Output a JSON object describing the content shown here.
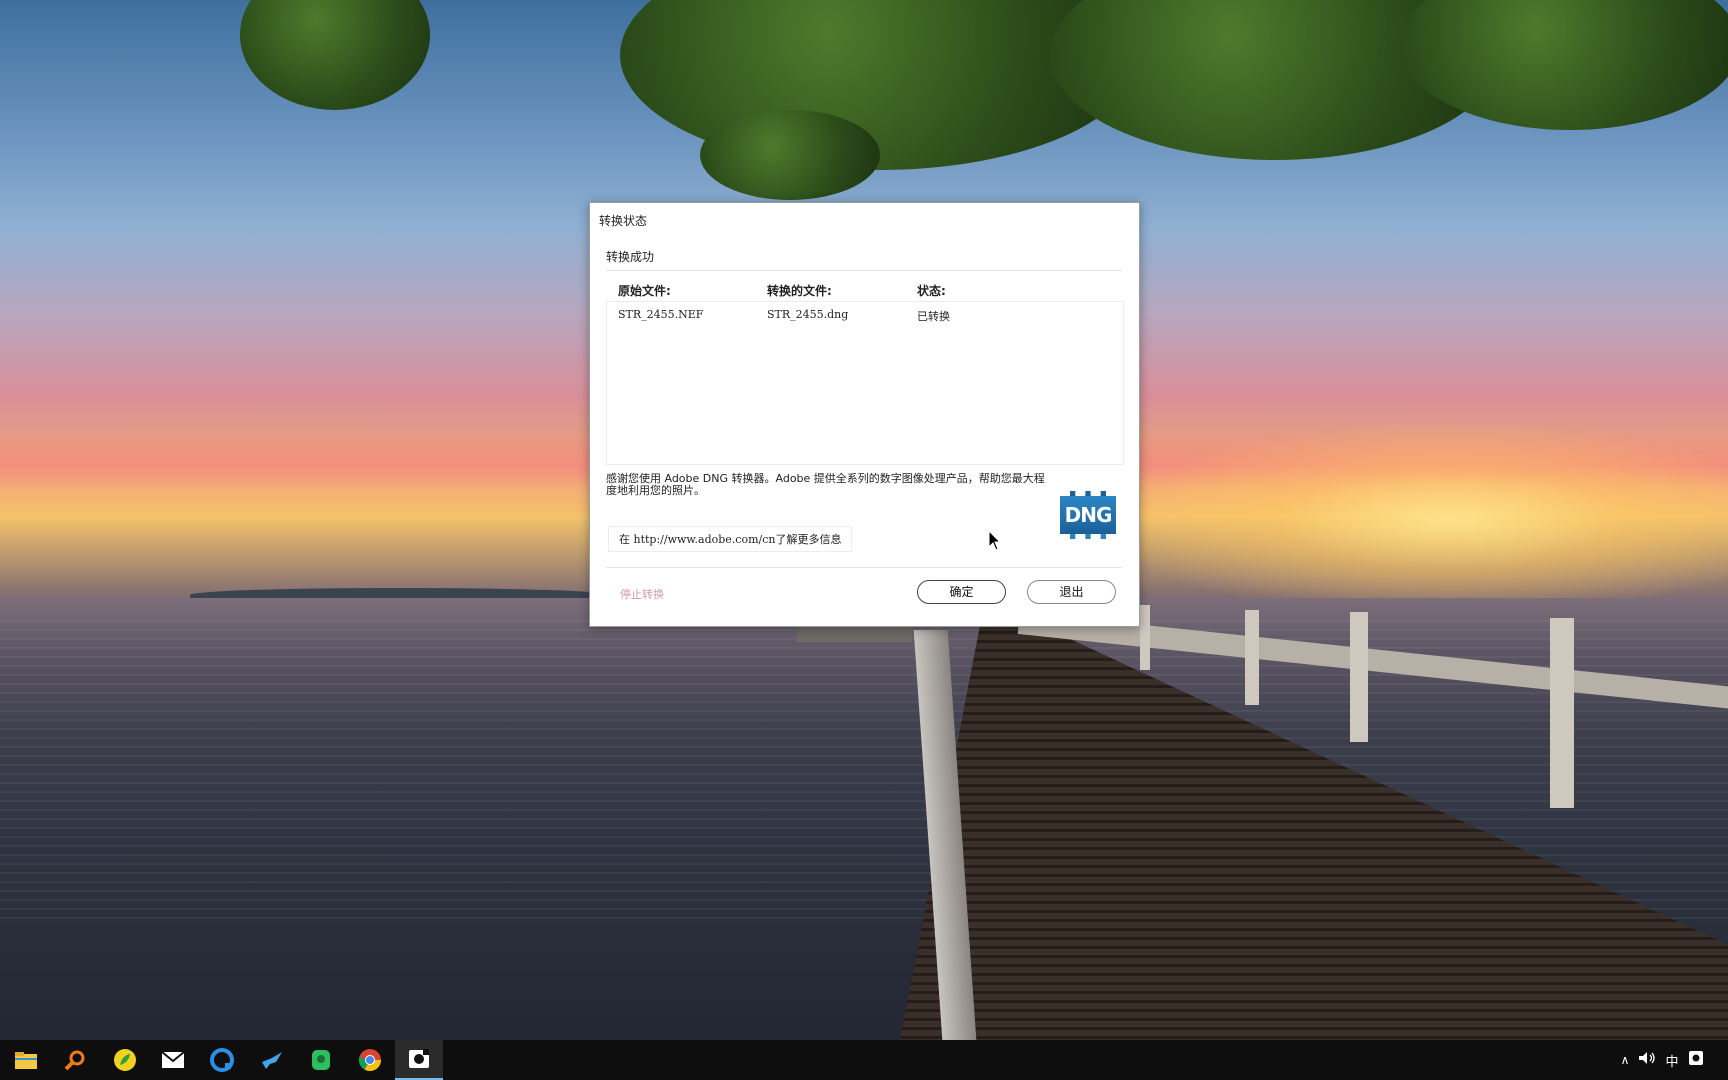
{
  "dialog": {
    "title": "转换状态",
    "section_title": "转换成功",
    "columns": [
      "原始文件:",
      "转换的文件:",
      "状态:"
    ],
    "rows": [
      {
        "original": "STR_2455.NEF",
        "converted": "STR_2455.dng",
        "status": "已转换"
      }
    ],
    "thanks_text": "感谢您使用 Adobe DNG 转换器。Adobe 提供全系列的数字图像处理产品，帮助您最大程度地利用您的照片。",
    "logo_text": "DNG",
    "info_link": "在 http://www.adobe.com/cn了解更多信息",
    "stop_label": "停止转换",
    "ok_label": "确定",
    "quit_label": "退出"
  },
  "taskbar": {
    "items": [
      "file-explorer",
      "search",
      "app-green",
      "mail",
      "browser-blue",
      "bird-app",
      "evernote",
      "chrome",
      "dng-converter"
    ],
    "ime_label": "中"
  },
  "colors": {
    "dialog_bg": "#ffffff",
    "stop_link": "#d39aa2",
    "dng_blue": "#1b5f99",
    "taskbar": "#0e0e0e"
  }
}
